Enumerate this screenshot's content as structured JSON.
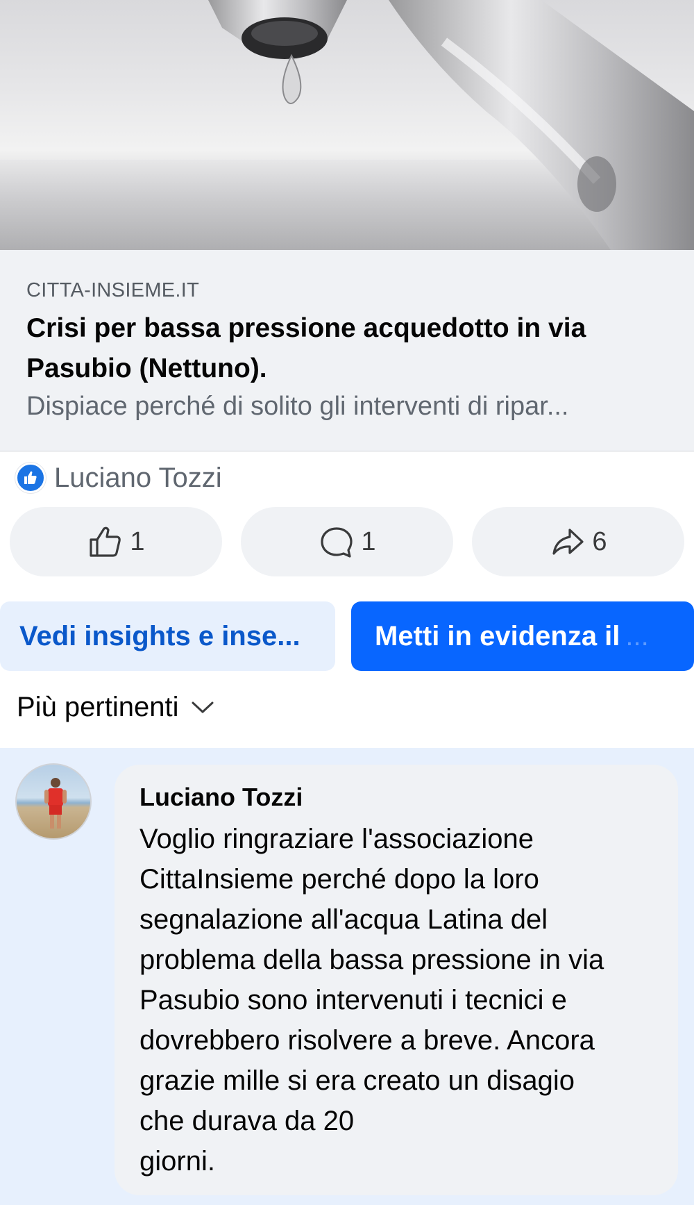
{
  "link_preview": {
    "domain": "CITTA-INSIEME.IT",
    "title": "Crisi per bassa pressione acquedotto in via Pasubio (Nettuno).",
    "description": "Dispiace perché di solito gli interventi di ripar..."
  },
  "reactions": {
    "reactor_name": "Luciano Tozzi",
    "icon": "thumbs-up-icon",
    "accent": "#1b74e4"
  },
  "actions": {
    "like_count": "1",
    "comment_count": "1",
    "share_count": "6"
  },
  "buttons": {
    "insights_label": "Vedi insights e inse...",
    "boost_label": "Metti in evidenza il",
    "boost_ellipsis": "..."
  },
  "sort": {
    "label": "Più pertinenti"
  },
  "comment": {
    "author": "Luciano Tozzi",
    "lines": [
      "Voglio ringraziare l'associazione",
      "CittaInsieme perché dopo la loro",
      "segnalazione all'acqua Latina del",
      "problema della bassa pressione in via",
      "Pasubio sono intervenuti i tecnici e",
      "dovrebbero risolvere a breve. Ancora",
      "grazie mille si era creato un disagio",
      "che durava da 20",
      "giorni."
    ]
  },
  "colors": {
    "primary_blue": "#0866ff",
    "light_blue_bg": "#e7f0fd",
    "link_blue": "#0a58ca",
    "gray_bg": "#f0f2f5"
  }
}
